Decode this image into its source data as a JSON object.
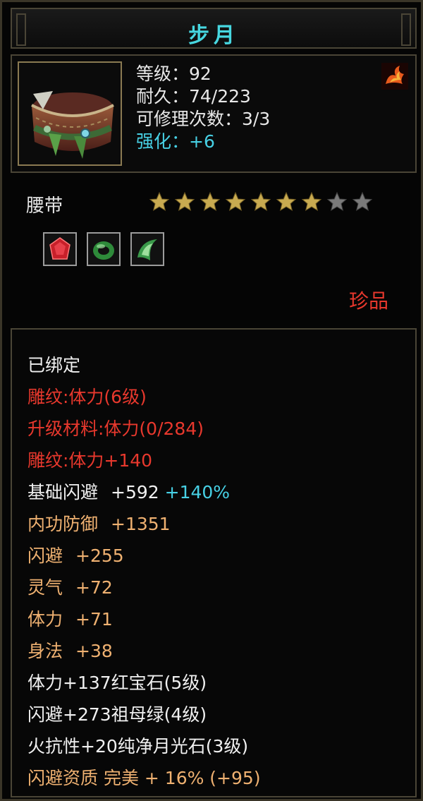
{
  "title": "步月",
  "info": {
    "level": "等级：92",
    "durability": "耐久：74/223",
    "repairs": "可修理次数：3/3",
    "enhance": "强化：+6"
  },
  "item_type": "腰带",
  "stars": {
    "filled": 7,
    "total": 9
  },
  "gems": [
    "ruby",
    "emerald-ring",
    "moonstone"
  ],
  "quality": "珍品",
  "attributes": {
    "bound": "已绑定",
    "engrave1": "雕纹:体力(6级)",
    "upgrade_material": "升级材料:体力(0/284)",
    "engrave2": "雕纹:体力+140",
    "dodge_base_label": "基础闪避",
    "dodge_base_value": "+592",
    "dodge_base_percent": "+140%",
    "inner_def_label": "内功防御",
    "inner_def_value": "+1351",
    "dodge_label": "闪避",
    "dodge_value": "+255",
    "spirit_label": "灵气",
    "spirit_value": "+72",
    "stamina_label": "体力",
    "stamina_value": "+71",
    "agility_label": "身法",
    "agility_value": "+38",
    "gem1": "体力+137红宝石(5级)",
    "gem2": "闪避+273祖母绿(4级)",
    "gem3": "火抗性+20纯净月光石(3级)",
    "aptitude": "闪避资质 完美 + 16% (+95)"
  },
  "colors": {
    "cyan": "#47d0e4",
    "red": "#e8382d",
    "orange": "#efb171",
    "gold": "#c8aa50"
  }
}
